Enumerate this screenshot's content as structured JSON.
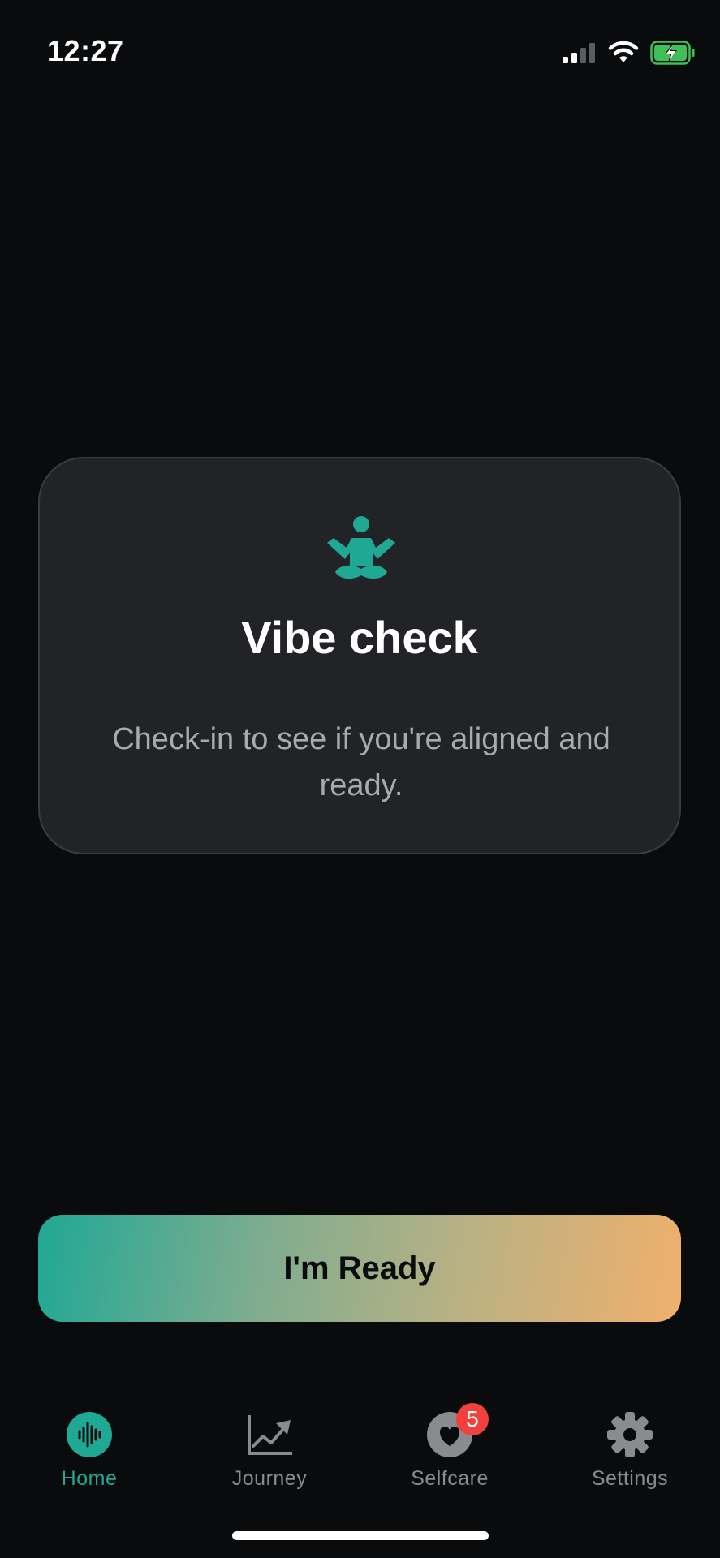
{
  "status_bar": {
    "time": "12:27",
    "icons": [
      "signal-icon",
      "wifi-icon",
      "battery-charging-icon"
    ]
  },
  "card": {
    "icon": "meditation-icon",
    "title": "Vibe check",
    "description": "Check-in to see if you're aligned and ready."
  },
  "ready_button": {
    "label": "I'm Ready"
  },
  "tab_bar": {
    "tabs": [
      {
        "label": "Home",
        "icon": "sound-wave-icon",
        "active": true
      },
      {
        "label": "Journey",
        "icon": "chart-line-icon",
        "active": false
      },
      {
        "label": "Selfcare",
        "icon": "heart-icon",
        "active": false,
        "badge": "5"
      },
      {
        "label": "Settings",
        "icon": "gear-icon",
        "active": false
      }
    ]
  },
  "colors": {
    "background": "#0a0b0d",
    "accent": "#22a893",
    "card_background": "#222326",
    "badge": "#f2413c",
    "gradient_start": "#1fa895",
    "gradient_end": "#f0b06c"
  }
}
